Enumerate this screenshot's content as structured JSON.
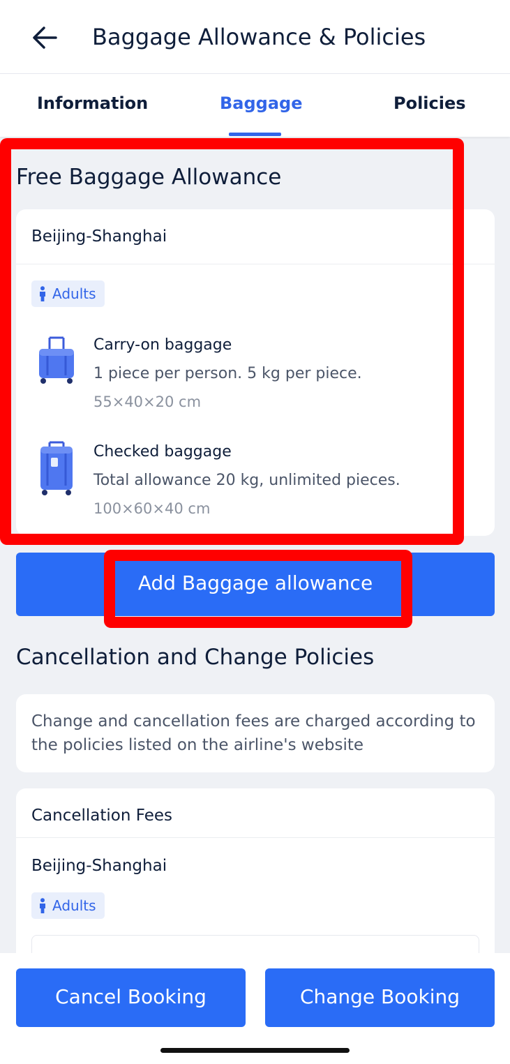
{
  "header": {
    "title": "Baggage Allowance & Policies",
    "back_icon": "arrow-left-icon"
  },
  "tabs": [
    {
      "label": "Information",
      "active": false
    },
    {
      "label": "Baggage",
      "active": true
    },
    {
      "label": "Policies",
      "active": false
    }
  ],
  "baggage": {
    "section_title": "Free Baggage Allowance",
    "route": "Beijing-Shanghai",
    "passenger_type": "Adults",
    "passenger_icon": "person-icon",
    "items": [
      {
        "title": "Carry-on baggage",
        "description": "1 piece per person. 5 kg per piece.",
        "dimensions": "55×40×20 cm",
        "icon": "carry-on-suitcase-icon"
      },
      {
        "title": "Checked baggage",
        "description": "Total allowance 20 kg, unlimited pieces.",
        "dimensions": "100×60×40 cm",
        "icon": "checked-suitcase-icon"
      }
    ],
    "add_button_label": "Add Baggage allowance"
  },
  "policies": {
    "section_title": "Cancellation and Change Policies",
    "notice": "Change and cancellation fees are charged according to the policies listed on the airline's website",
    "cancellation_fees": {
      "title": "Cancellation Fees",
      "route": "Beijing-Shanghai",
      "passenger_type": "Adults"
    }
  },
  "bottom_bar": {
    "cancel_label": "Cancel Booking",
    "change_label": "Change Booking"
  },
  "colors": {
    "accent": "#2a6cf6",
    "tab_active": "#3265e8",
    "highlight": "#ff0000",
    "background": "#eff1f5"
  }
}
